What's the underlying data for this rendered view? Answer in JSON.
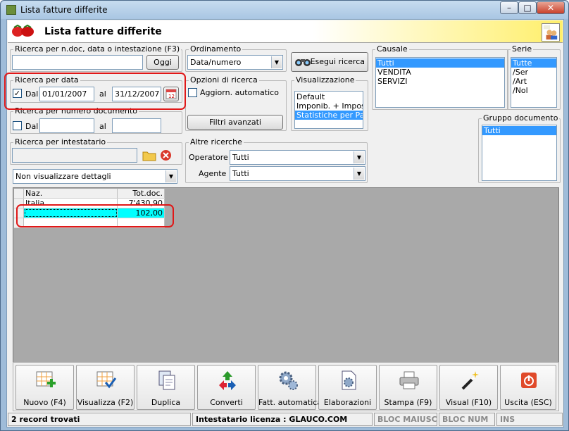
{
  "window": {
    "title": "Lista fatture differite"
  },
  "header": {
    "title": "Lista fatture differite"
  },
  "search_text": {
    "label": "Ricerca per n.doc, data o intestazione (F3)",
    "value": "",
    "oggi_label": "Oggi"
  },
  "ordinamento": {
    "label": "Ordinamento",
    "selected": "Data/numero"
  },
  "esegui_label": "Esegui ricerca",
  "data_search": {
    "label": "Ricerca per data",
    "checked": true,
    "dal_label": "Dal",
    "dal_value": "01/01/2007",
    "al_label": "al",
    "al_value": "31/12/2007"
  },
  "numero_search": {
    "label": "Ricerca per numero documento",
    "checked": false,
    "dal_label": "Dal",
    "dal_value": "",
    "al_label": "al",
    "al_value": ""
  },
  "opzioni": {
    "label": "Opzioni di ricerca",
    "auto_label": "Aggiorn. automatico",
    "auto_checked": false,
    "filtri_label": "Filtri avanzati"
  },
  "visualizzazione": {
    "label": "Visualizzazione",
    "items": [
      "Default",
      "Imponib. + Imposte",
      "Statistiche per Paes"
    ],
    "selected_index": 2
  },
  "causale": {
    "label": "Causale",
    "items": [
      "Tutti",
      "VENDITA",
      "SERVIZI"
    ],
    "selected_index": 0
  },
  "serie": {
    "label": "Serie",
    "items": [
      "Tutte",
      "/Ser",
      "/Art",
      "/Nol"
    ],
    "selected_index": 0
  },
  "gruppo": {
    "label": "Gruppo documento",
    "items": [
      "Tutti"
    ],
    "selected_index": 0
  },
  "intestatario": {
    "label": "Ricerca per intestatario",
    "value": ""
  },
  "dettagli": {
    "selected": "Non visualizzare dettagli"
  },
  "altre": {
    "label": "Altre ricerche",
    "operatore_label": "Operatore :",
    "operatore_value": "Tutti",
    "agente_label": "Agente :",
    "agente_value": "Tutti"
  },
  "grid": {
    "columns": [
      "Naz.",
      "Tot.doc."
    ],
    "rows": [
      [
        "Italia",
        "7'430,90"
      ],
      [
        "",
        "102,00"
      ]
    ]
  },
  "toolbar": [
    {
      "label": "Nuovo (F4)",
      "icon": "new-grid-icon"
    },
    {
      "label": "Visualizza (F2)",
      "icon": "view-grid-icon"
    },
    {
      "label": "Duplica",
      "icon": "duplicate-icon"
    },
    {
      "label": "Converti",
      "icon": "convert-icon"
    },
    {
      "label": "Fatt. automatica",
      "icon": "automatic-gear-icon"
    },
    {
      "label": "Elaborazioni",
      "icon": "processing-doc-icon"
    },
    {
      "label": "Stampa (F9)",
      "icon": "printer-icon"
    },
    {
      "label": "Visual (F10)",
      "icon": "magic-wand-icon"
    },
    {
      "label": "Uscita (ESC)",
      "icon": "exit-icon"
    }
  ],
  "status": {
    "records": "2 record trovati",
    "license": "Intestatario licenza : GLAUCO.COM",
    "caps": "BLOC MAIUSC",
    "num": "BLOC NUM",
    "ins": "INS"
  },
  "colors": {
    "highlight_cyan": "#00ffff",
    "selection_blue": "#3399ff",
    "annotation_red": "#e01818"
  }
}
